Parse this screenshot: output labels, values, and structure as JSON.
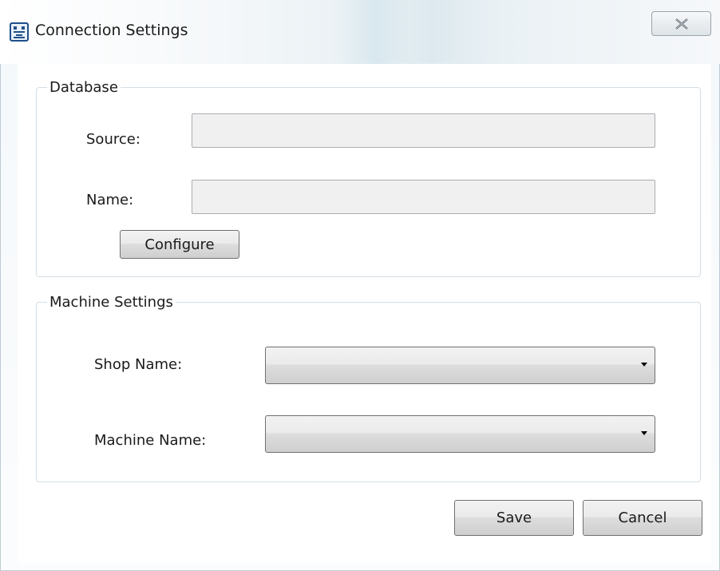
{
  "window": {
    "title": "Connection Settings",
    "icon": "app-window-icon",
    "close_icon": "close-icon"
  },
  "database": {
    "legend": "Database",
    "source_label": "Source:",
    "source_value": "",
    "name_label": "Name:",
    "name_value": "",
    "configure_label": "Configure"
  },
  "machine": {
    "legend": "Machine Settings",
    "shop_label": "Shop Name:",
    "shop_value": "",
    "machine_label": "Machine Name:",
    "machine_value": ""
  },
  "footer": {
    "save_label": "Save",
    "cancel_label": "Cancel"
  }
}
